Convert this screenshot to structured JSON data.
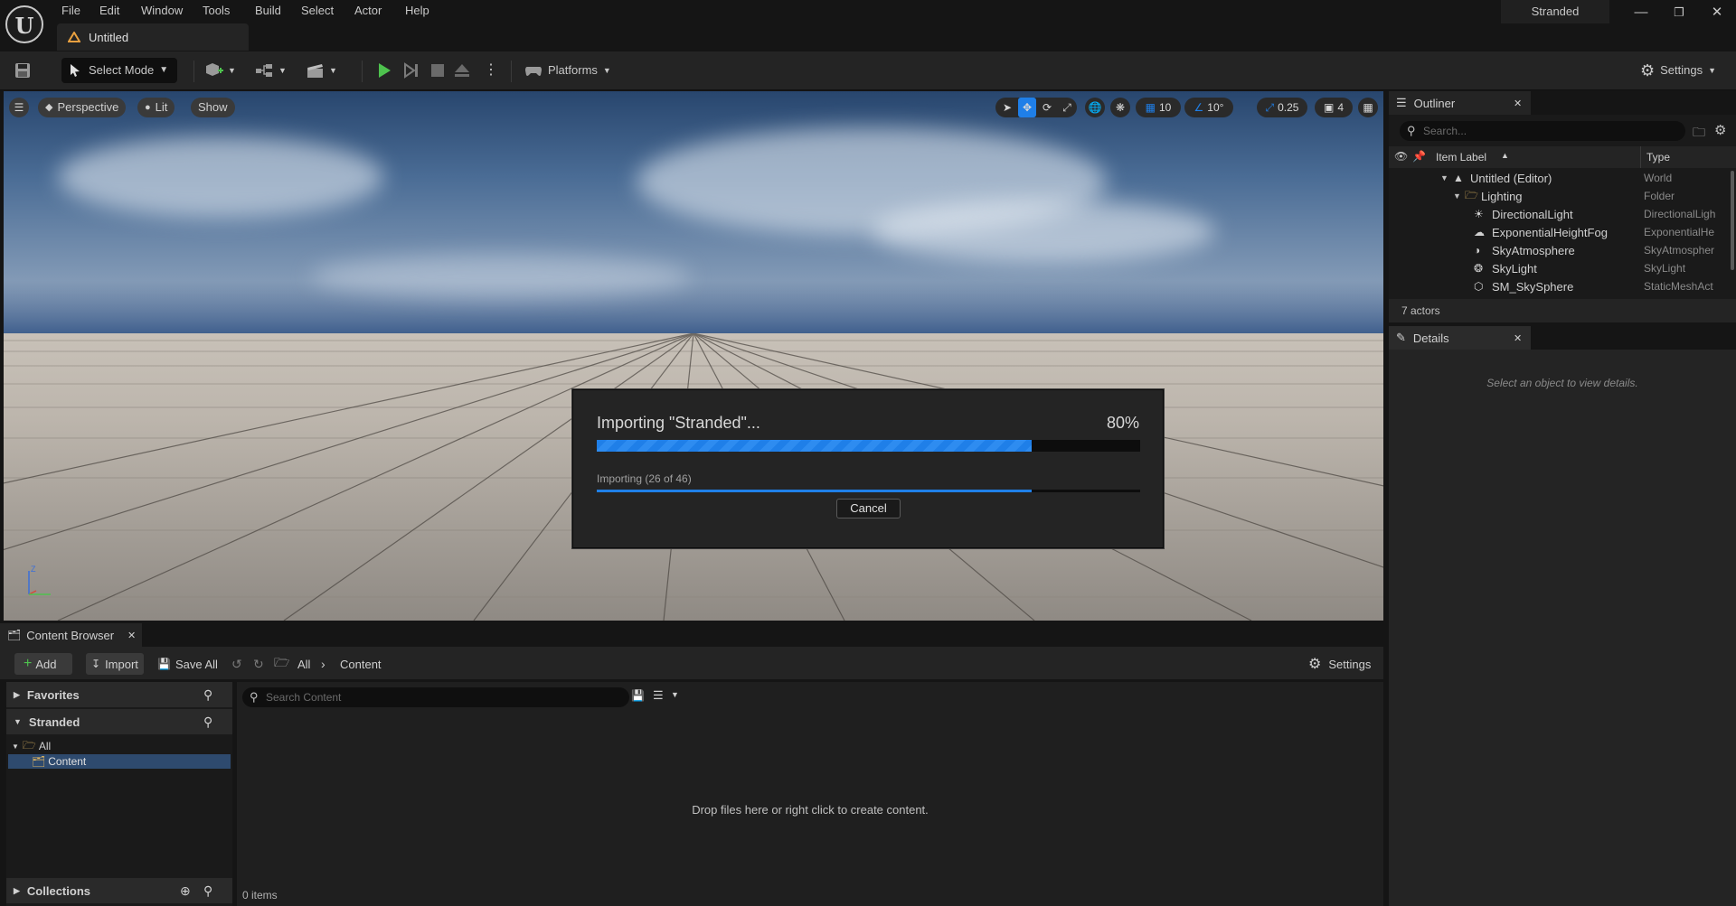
{
  "menu": [
    "File",
    "Edit",
    "Window",
    "Tools",
    "Build",
    "Select",
    "Actor",
    "Help"
  ],
  "document_tab": "Untitled",
  "project_name": "Stranded",
  "toolbar": {
    "mode_label": "Select Mode",
    "platforms_label": "Platforms",
    "settings_label": "Settings"
  },
  "viewport": {
    "perspective_label": "Perspective",
    "lit_label": "Lit",
    "show_label": "Show",
    "grid_snap": "10",
    "rotation_snap": "10°",
    "scale_snap": "0.25",
    "camera_speed": "4",
    "axis_z": "Z",
    "sky_color": "#4a6c95"
  },
  "import_dialog": {
    "title": "Importing \"Stranded\"...",
    "percent_label": "80%",
    "progress": 0.8,
    "sub_status": "Importing (26 of 46)",
    "sub_progress": 0.8,
    "cancel_label": "Cancel",
    "accent": "#1f7fe8"
  },
  "outliner": {
    "tab_label": "Outliner",
    "search_placeholder": "Search...",
    "col_label": "Item Label",
    "col_type": "Type",
    "rows": [
      {
        "label": "Untitled (Editor)",
        "type": "World",
        "icon": "world-icon",
        "indent": 0
      },
      {
        "label": "Lighting",
        "type": "Folder",
        "icon": "folder-icon",
        "indent": 1
      },
      {
        "label": "DirectionalLight",
        "type": "DirectionalLigh",
        "icon": "directional-light-icon",
        "indent": 2
      },
      {
        "label": "ExponentialHeightFog",
        "type": "ExponentialHe",
        "icon": "fog-icon",
        "indent": 2
      },
      {
        "label": "SkyAtmosphere",
        "type": "SkyAtmospher",
        "icon": "sky-atmosphere-icon",
        "indent": 2
      },
      {
        "label": "SkyLight",
        "type": "SkyLight",
        "icon": "sky-light-icon",
        "indent": 2
      },
      {
        "label": "SM_SkySphere",
        "type": "StaticMeshAct",
        "icon": "static-mesh-icon",
        "indent": 2
      }
    ],
    "actor_count": "7 actors"
  },
  "details": {
    "tab_label": "Details",
    "empty_text": "Select an object to view details."
  },
  "content_browser": {
    "tab_label": "Content Browser",
    "add_label": "Add",
    "import_label": "Import",
    "save_all_label": "Save All",
    "breadcrumb": [
      "All",
      "Content"
    ],
    "settings_label": "Settings",
    "favorites_label": "Favorites",
    "project_label": "Stranded",
    "tree": [
      "All",
      "Content"
    ],
    "collections_label": "Collections",
    "search_placeholder": "Search Content",
    "drop_hint": "Drop files here or right click to create content.",
    "item_count": "0 items"
  }
}
